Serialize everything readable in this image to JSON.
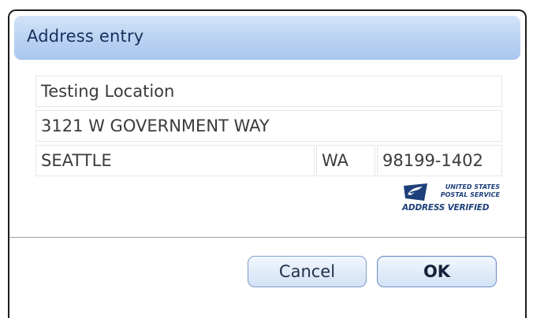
{
  "window": {
    "title": "Address entry"
  },
  "address": {
    "name": "Testing Location",
    "street": "3121 W GOVERNMENT WAY",
    "city": "SEATTLE",
    "state": "WA",
    "zip": "98199-1402"
  },
  "verification": {
    "line1": "UNITED STATES",
    "line2": "POSTAL SERVICE",
    "line3": "ADDRESS VERIFIED",
    "icon": "usps-eagle-icon",
    "color": "#1d3f7a"
  },
  "buttons": {
    "cancel": "Cancel",
    "ok": "OK"
  },
  "colors": {
    "titlebar": "#bdd5f3",
    "title_text": "#172f5c",
    "button_border": "#7f9cc9"
  }
}
